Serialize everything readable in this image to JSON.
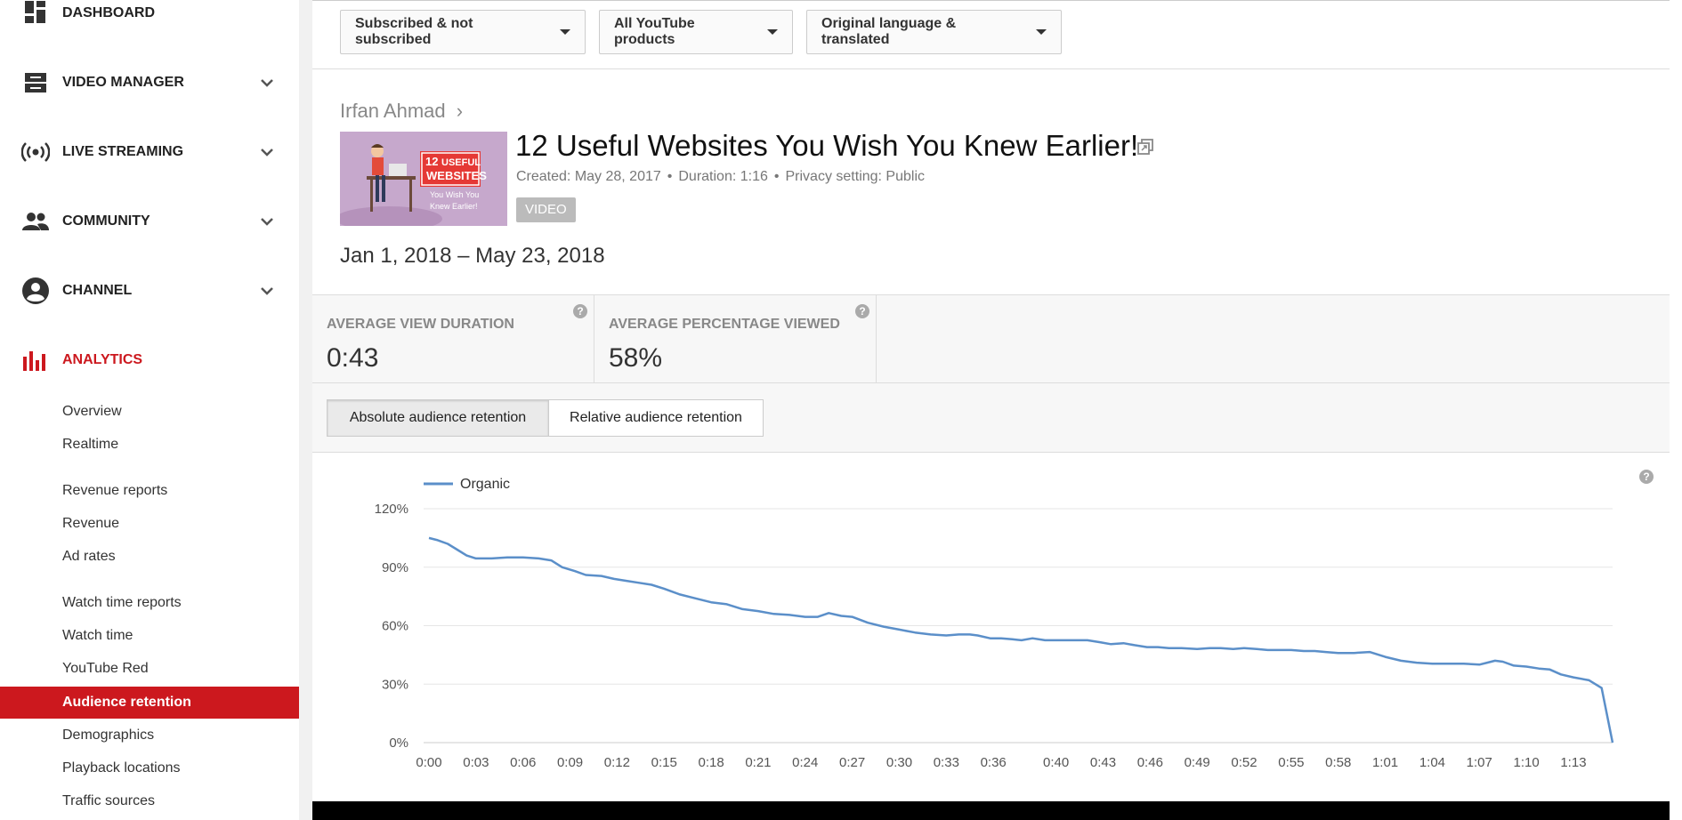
{
  "sidebar": {
    "items": [
      {
        "label": "DASHBOARD",
        "icon": "dashboard-icon",
        "expandable": false
      },
      {
        "label": "VIDEO MANAGER",
        "icon": "video-manager-icon",
        "expandable": true
      },
      {
        "label": "LIVE STREAMING",
        "icon": "live-streaming-icon",
        "expandable": true
      },
      {
        "label": "COMMUNITY",
        "icon": "community-icon",
        "expandable": true
      },
      {
        "label": "CHANNEL",
        "icon": "channel-icon",
        "expandable": true
      },
      {
        "label": "ANALYTICS",
        "icon": "analytics-icon",
        "expandable": false,
        "active": true
      }
    ],
    "analytics_sub": [
      {
        "label": "Overview"
      },
      {
        "label": "Realtime"
      },
      {
        "label": "Revenue reports",
        "header": true
      },
      {
        "label": "Revenue"
      },
      {
        "label": "Ad rates"
      },
      {
        "label": "Watch time reports",
        "header": true
      },
      {
        "label": "Watch time"
      },
      {
        "label": "YouTube Red"
      },
      {
        "label": "Audience retention",
        "selected": true
      },
      {
        "label": "Demographics"
      },
      {
        "label": "Playback locations"
      },
      {
        "label": "Traffic sources"
      }
    ]
  },
  "filters": [
    {
      "label": "Subscribed & not subscribed"
    },
    {
      "label": "All YouTube products"
    },
    {
      "label": "Original language & translated"
    }
  ],
  "video": {
    "channel": "Irfan Ahmad",
    "breadcrumb_sep": "›",
    "title": "12 Useful Websites You Wish You Knew Earlier!",
    "created": "Created: May 28, 2017",
    "duration": "Duration: 1:16",
    "privacy": "Privacy setting: Public",
    "meta_sep": "•",
    "badge": "VIDEO",
    "thumbnail_text": {
      "line1": "12",
      "line2": "USEFUL",
      "line3": "WEBSITES",
      "line4": "You Wish You",
      "line5": "Knew Earlier!"
    }
  },
  "date_range": "Jan 1, 2018 – May 23, 2018",
  "metrics": [
    {
      "label": "AVERAGE VIEW DURATION",
      "value": "0:43"
    },
    {
      "label": "AVERAGE PERCENTAGE VIEWED",
      "value": "58%"
    }
  ],
  "help_glyph": "?",
  "tabs": [
    {
      "label": "Absolute audience retention",
      "active": true
    },
    {
      "label": "Relative audience retention",
      "active": false
    }
  ],
  "colors": {
    "accent": "#cc181e",
    "line": "#5b8fc9"
  },
  "chart_data": {
    "type": "line",
    "xlabel": "",
    "ylabel": "",
    "ylim": [
      0,
      120
    ],
    "yticks": [
      "0%",
      "30%",
      "60%",
      "90%",
      "120%"
    ],
    "ytick_values": [
      0,
      30,
      60,
      90,
      120
    ],
    "xticks": [
      "0:00",
      "0:03",
      "0:06",
      "0:09",
      "0:12",
      "0:15",
      "0:18",
      "0:21",
      "0:24",
      "0:27",
      "0:30",
      "0:33",
      "0:36",
      "0:40",
      "0:43",
      "0:46",
      "0:49",
      "0:52",
      "0:55",
      "0:58",
      "1:01",
      "1:04",
      "1:07",
      "1:10",
      "1:13"
    ],
    "xtick_seconds": [
      0,
      3,
      6,
      9,
      12,
      15,
      18,
      21,
      24,
      27,
      30,
      33,
      36,
      40,
      43,
      46,
      49,
      52,
      55,
      58,
      61,
      64,
      67,
      70,
      73
    ],
    "xlim_seconds": [
      0,
      75.5
    ],
    "legend_position": "top-left",
    "grid": true,
    "series": [
      {
        "name": "Organic",
        "x": [
          0,
          0.5,
          1.2,
          1.8,
          2.4,
          3,
          4,
          5,
          6,
          7,
          7.8,
          8.5,
          9.3,
          10,
          11,
          11.8,
          12.6,
          13.4,
          14.2,
          15,
          16,
          17,
          18,
          19,
          20,
          21,
          22,
          23,
          24,
          24.8,
          25.5,
          26.3,
          27,
          28,
          29,
          30,
          31,
          32,
          33,
          33.8,
          34.5,
          35,
          35.8,
          36.5,
          37.2,
          37.8,
          38.5,
          39.3,
          40,
          41,
          42,
          42.8,
          43.5,
          44.3,
          45,
          45.8,
          46.5,
          47.2,
          48,
          49,
          49.8,
          50.5,
          51.3,
          52,
          52.8,
          53.5,
          54.3,
          55,
          55.8,
          56.5,
          57.2,
          58,
          59,
          60,
          61,
          62,
          63,
          64,
          65,
          66,
          67,
          67.5,
          68,
          68.5,
          69.2,
          70,
          70.8,
          71.5,
          72.2,
          73,
          74,
          74.8,
          75.5
        ],
        "values": [
          105,
          104,
          102,
          99,
          96,
          94.5,
          94.5,
          95,
          95,
          94.5,
          93.5,
          90,
          88,
          86,
          85.5,
          84,
          83,
          82,
          81,
          79,
          76,
          74,
          72,
          71,
          68.5,
          67.5,
          66,
          65.5,
          64.5,
          64.5,
          66.5,
          65,
          64.5,
          61.5,
          59.5,
          58,
          56.5,
          55.5,
          55,
          55.5,
          55.5,
          55,
          53.5,
          53.5,
          53,
          52.5,
          53.5,
          52.5,
          52.5,
          52.5,
          52.5,
          51.5,
          50.5,
          51,
          50,
          49,
          49,
          48.5,
          48.5,
          48,
          48.5,
          48.5,
          48,
          48.5,
          48,
          47.5,
          47.5,
          47.5,
          47,
          47,
          46.5,
          46,
          46,
          46.5,
          44,
          42,
          41,
          40.5,
          40.5,
          40.5,
          40,
          41,
          42,
          41.5,
          39.5,
          39,
          38,
          37.5,
          35,
          33.5,
          32,
          28,
          0
        ]
      }
    ]
  }
}
